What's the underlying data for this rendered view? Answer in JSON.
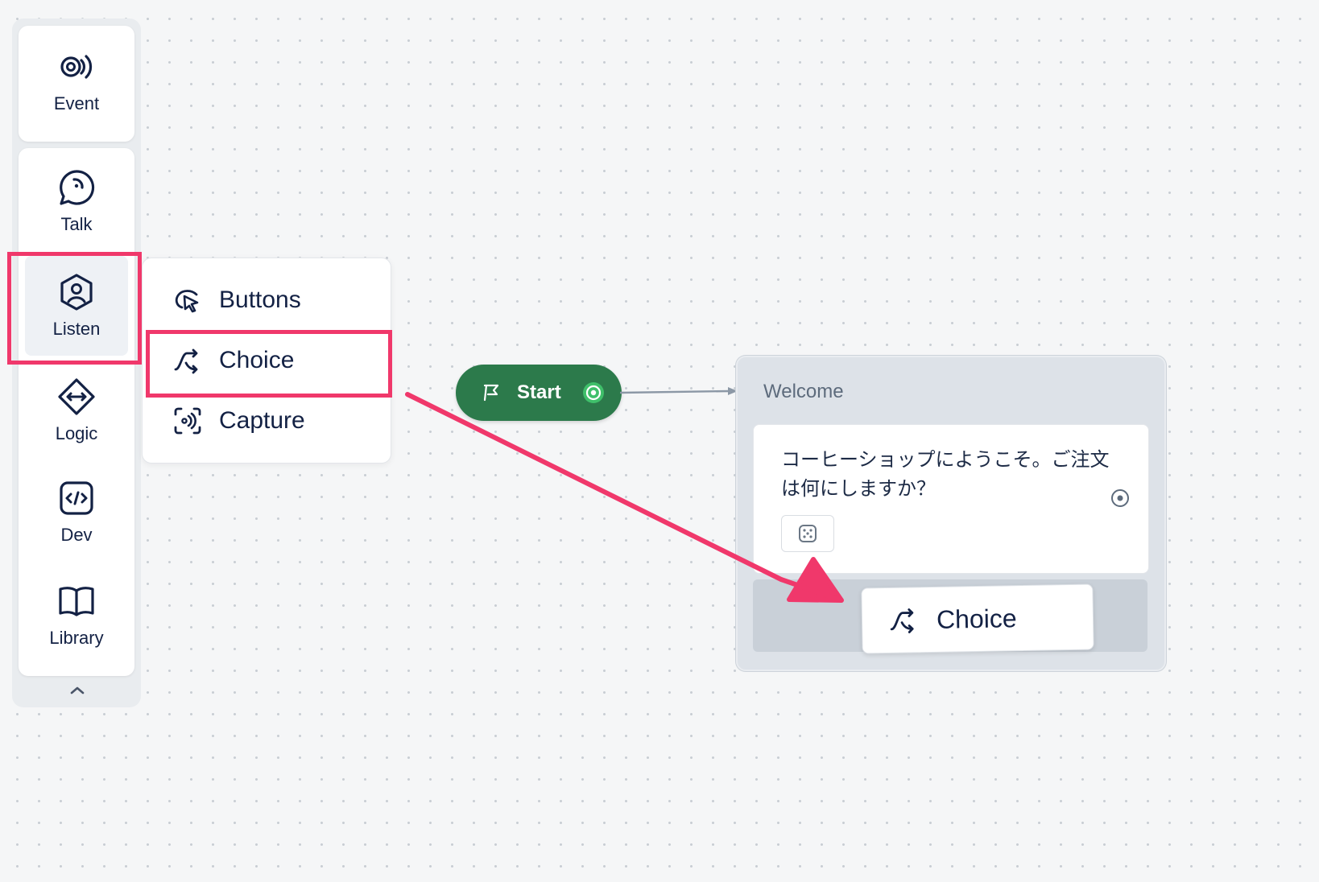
{
  "sidebar": {
    "items": [
      {
        "label": "Event",
        "icon": "event-icon"
      },
      {
        "label": "Talk",
        "icon": "talk-icon"
      },
      {
        "label": "Listen",
        "icon": "listen-icon"
      },
      {
        "label": "Logic",
        "icon": "logic-icon"
      },
      {
        "label": "Dev",
        "icon": "dev-icon"
      },
      {
        "label": "Library",
        "icon": "library-icon"
      }
    ],
    "collapse_icon": "chevron-up-icon"
  },
  "listen_menu": {
    "items": [
      {
        "label": "Buttons",
        "icon": "buttons-icon"
      },
      {
        "label": "Choice",
        "icon": "choice-icon"
      },
      {
        "label": "Capture",
        "icon": "capture-icon"
      }
    ]
  },
  "canvas": {
    "start_node": {
      "label": "Start",
      "icon": "flag-icon"
    },
    "welcome_block": {
      "title": "Welcome",
      "message": "コーヒーショップにようこそ。ご注文は何にしますか？",
      "variant_icon": "dice-icon"
    },
    "dragged_step": {
      "label": "Choice",
      "icon": "choice-icon"
    }
  },
  "colors": {
    "highlight": "#f0386b",
    "start_green": "#2c7a4b",
    "text_dark": "#132144"
  }
}
